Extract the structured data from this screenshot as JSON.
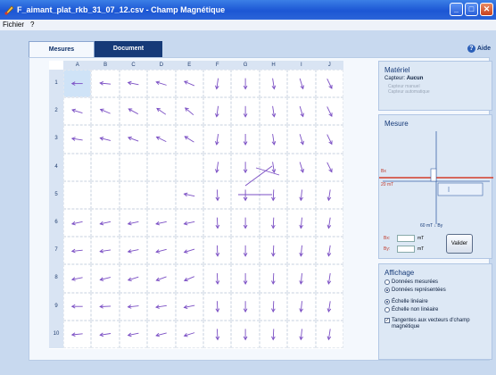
{
  "window": {
    "title": "F_aimant_plat_rkb_31_07_12.csv - Champ Magnétique",
    "buttons": [
      "_",
      "□",
      "✕"
    ]
  },
  "menu": [
    "Fichier",
    "?"
  ],
  "tabs": [
    {
      "label": "Mesures",
      "active": true
    },
    {
      "label": "Document",
      "active": false
    }
  ],
  "help_label": "Aide",
  "grid": {
    "columns": [
      "A",
      "B",
      "C",
      "D",
      "E",
      "F",
      "G",
      "H",
      "I",
      "J"
    ],
    "rows": [
      "1",
      "2",
      "3",
      "4",
      "5",
      "6",
      "7",
      "8",
      "9",
      "10"
    ],
    "selected_cell": "A1",
    "arrow_color": "#7b4fc4"
  },
  "materiel": {
    "title": "Matériel",
    "capteur_label": "Capteur:",
    "capteur_value": "Aucun",
    "option1": "Capteur manuel",
    "option2": "Capteur automatique"
  },
  "mesure": {
    "title": "Mesure",
    "bx_top": "Bx",
    "bx_scale": "20 mT",
    "by_axis": "60 mT ↓ By",
    "bx_label": "Bx:",
    "by_label": "By:",
    "unit1": "mT",
    "unit2": "mT",
    "valider": "Valider"
  },
  "affichage": {
    "title": "Affichage",
    "opt_mesurees": "Données mesurées",
    "opt_representees": "Données représentées",
    "opt_lineaire": "Échelle linéaire",
    "opt_non_lineaire": "Échelle non linéaire",
    "opt_tangentes": "Tangentes aux vecteurs d'champ magnétique"
  }
}
